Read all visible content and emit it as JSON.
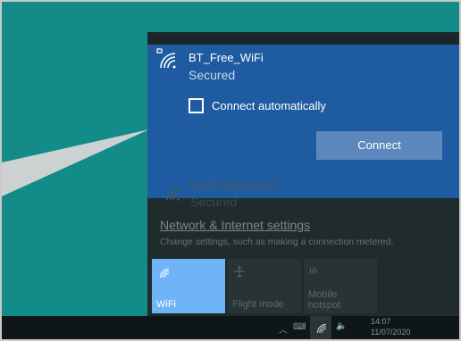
{
  "network_selected": {
    "ssid": "BT_Free_WiFi",
    "status": "Secured",
    "connect_auto_label": "Connect automatically",
    "connect_auto_checked": false,
    "connect_button": "Connect"
  },
  "network_other": {
    "ssid": "UWE Authorised",
    "status": "Secured"
  },
  "settings": {
    "link": "Network & Internet settings",
    "hint": "Change settings, such as making a connection metered."
  },
  "quick_actions": [
    {
      "label": "WiFi",
      "active": true,
      "icon": "wifi-icon"
    },
    {
      "label": "Flight mode",
      "active": false,
      "icon": "airplane-icon"
    },
    {
      "label": "Mobile hotspot",
      "line1": "Mobile",
      "line2": "hotspot",
      "active": false,
      "icon": "hotspot-icon"
    }
  ],
  "taskbar": {
    "time": "14:07",
    "date": "11/07/2020"
  },
  "colors": {
    "desktop": "#138b88",
    "selected_network": "#1e5ba1",
    "active_tile": "#6eb4f7",
    "flyout": "#1f2b2d"
  }
}
